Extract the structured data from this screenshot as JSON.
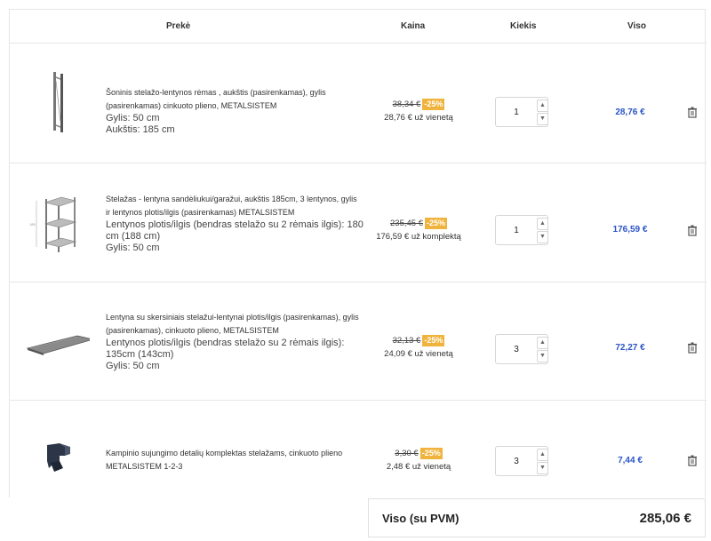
{
  "header": {
    "product": "Prekė",
    "price": "Kaina",
    "quantity": "Kiekis",
    "total": "Viso"
  },
  "items": [
    {
      "title": "Šoninis stelažo-lentynos rėmas , aukštis (pasirenkamas), gylis (pasirenkamas) cinkuoto plieno, METALSISTEM",
      "options": [
        "Gylis: 50 cm",
        "Aukštis: 185 cm"
      ],
      "old_price": "38,34 €",
      "discount": "-25%",
      "unit_price": "28,76 € už vienetą",
      "quantity": "1",
      "total": "28,76 €",
      "thumbnail_icon": "shelf-side-frame-image"
    },
    {
      "title": "Stelažas - lentyna sandėliukui/garažui, aukštis 185cm, 3 lentynos, gylis ir lentynos plotis/ilgis (pasirenkamas) METALSISTEM",
      "options": [
        "Lentynos plotis/ilgis (bendras stelažo su 2 rėmais ilgis): 180 cm (188 cm)",
        "Gylis: 50 cm"
      ],
      "old_price": "235,45 €",
      "discount": "-25%",
      "unit_price": "176,59 € už komplektą",
      "quantity": "1",
      "total": "176,59 €",
      "thumbnail_icon": "shelving-unit-image"
    },
    {
      "title": "Lentyna su skersiniais stelažui-lentynai plotis/ilgis (pasirenkamas), gylis (pasirenkamas), cinkuoto plieno, METALSISTEM",
      "options": [
        "Lentynos plotis/ilgis (bendras stelažo su 2 rėmais ilgis): 135cm (143cm)",
        "Gylis: 50 cm"
      ],
      "old_price": "32,13 €",
      "discount": "-25%",
      "unit_price": "24,09 € už vienetą",
      "quantity": "3",
      "total": "72,27 €",
      "thumbnail_icon": "shelf-board-image"
    },
    {
      "title": "Kampinio sujungimo detalių komplektas stelažams, cinkuoto plieno METALSISTEM 1-2-3",
      "options": [],
      "old_price": "3,30 €",
      "discount": "-25%",
      "unit_price": "2,48 € už vienetą",
      "quantity": "3",
      "total": "7,44 €",
      "thumbnail_icon": "corner-connector-image"
    }
  ],
  "summary": {
    "label": "Viso (su PVM)",
    "value": "285,06 €"
  },
  "colors": {
    "accent_total": "#2b54c7",
    "discount_badge": "#f0b43e",
    "border": "#e6e6e6"
  }
}
